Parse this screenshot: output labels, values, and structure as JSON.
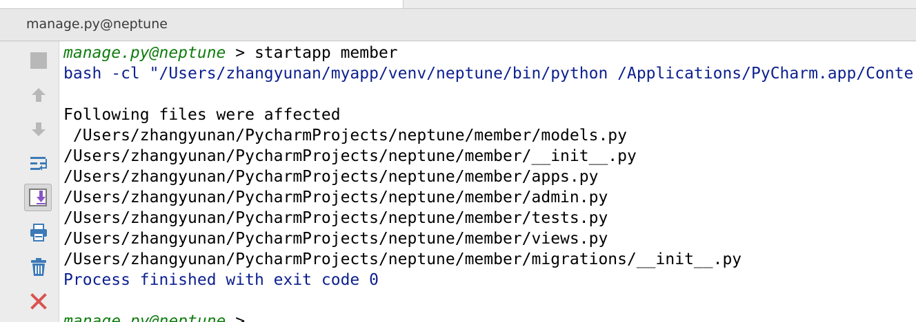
{
  "window": {
    "title": "manage.py@neptune"
  },
  "toolbar": {
    "items": [
      {
        "name": "stop",
        "icon": "stop-icon",
        "color": "#b8b8b8"
      },
      {
        "name": "scroll-up",
        "icon": "arrow-up-icon",
        "color": "#b8b8b8"
      },
      {
        "name": "scroll-down",
        "icon": "arrow-down-icon",
        "color": "#b8b8b8"
      },
      {
        "name": "soft-wrap",
        "icon": "soft-wrap-icon",
        "color": "#3c7ab8"
      },
      {
        "name": "scroll-to-end",
        "icon": "scroll-to-end-icon",
        "color": "#8a53c9",
        "selected": true
      },
      {
        "name": "print",
        "icon": "print-icon",
        "color": "#3c7ab8"
      },
      {
        "name": "clear-all",
        "icon": "trash-icon",
        "color": "#3c7ab8"
      },
      {
        "name": "close",
        "icon": "close-icon",
        "color": "#d9534f"
      }
    ]
  },
  "console": {
    "lines": [
      {
        "prompt": "manage.py@neptune",
        "text": " > startapp member"
      },
      {
        "text": "bash -cl \"/Users/zhangyunan/myapp/venv/neptune/bin/python /Applications/PyCharm.app/Conte"
      },
      {
        "text": ""
      },
      {
        "text": "Following files were affected"
      },
      {
        "text": " /Users/zhangyunan/PycharmProjects/neptune/member/models.py"
      },
      {
        "text": "/Users/zhangyunan/PycharmProjects/neptune/member/__init__.py"
      },
      {
        "text": "/Users/zhangyunan/PycharmProjects/neptune/member/apps.py"
      },
      {
        "text": "/Users/zhangyunan/PycharmProjects/neptune/member/admin.py"
      },
      {
        "text": "/Users/zhangyunan/PycharmProjects/neptune/member/tests.py"
      },
      {
        "text": "/Users/zhangyunan/PycharmProjects/neptune/member/views.py"
      },
      {
        "text": "/Users/zhangyunan/PycharmProjects/neptune/member/migrations/__init__.py"
      },
      {
        "text": "Process finished with exit code 0"
      },
      {
        "text": ""
      },
      {
        "prompt": "manage.py@neptune",
        "text": " >"
      }
    ]
  },
  "colors": {
    "prompt_green": "#0f7d0f",
    "command_blue": "#0c1f8f",
    "output_black": "#000000"
  }
}
